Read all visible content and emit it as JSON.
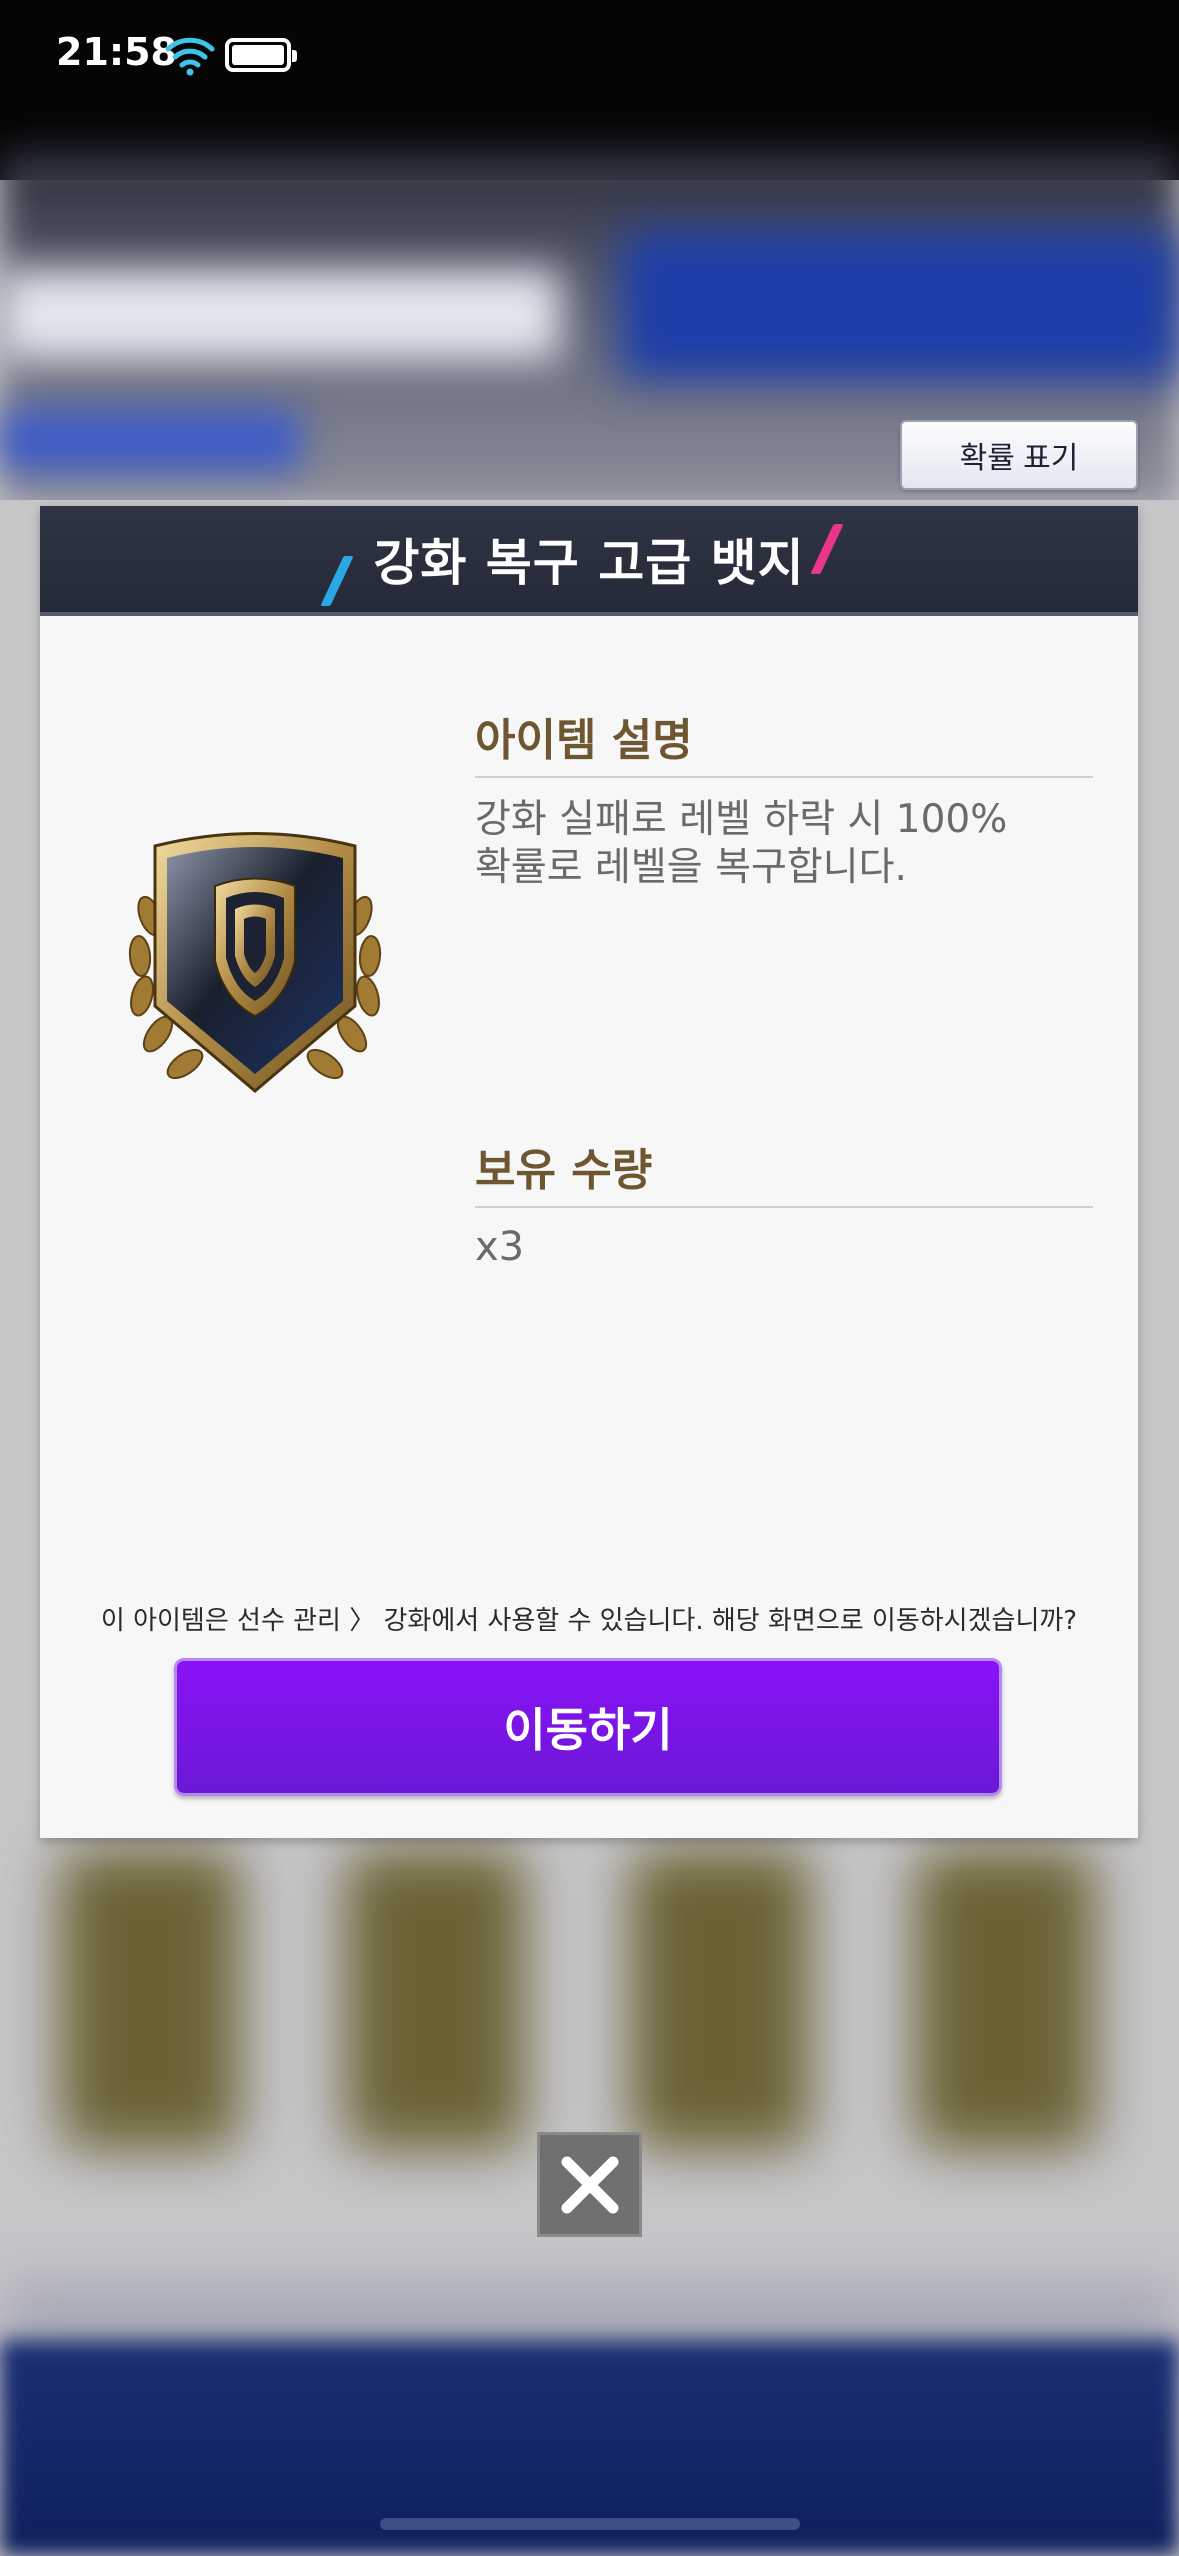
{
  "status_bar": {
    "time": "21:58"
  },
  "probability_button": {
    "label": "확률 표기"
  },
  "modal": {
    "title": "강화 복구 고급 뱃지",
    "description_heading": "아이템 설명",
    "description_lines": [
      "강화 실패로 레벨 하락 시 100%",
      "확률로 레벨을 복구합니다."
    ],
    "quantity_heading": "보유 수량",
    "quantity_value": "x3",
    "hint": "이 아이템은 선수 관리 〉 강화에서 사용할 수 있습니다. 해당 화면으로 이동하시겠습니까?",
    "move_button_label": "이동하기"
  },
  "colors": {
    "header_bg": "#2b3040",
    "accent_purple": "#7a14e8",
    "section_title": "#6d5630",
    "slash_blue": "#2aa8e6",
    "slash_pink": "#e8368a"
  },
  "icons": [
    "wifi-icon",
    "battery-icon",
    "shield-badge-icon",
    "close-icon"
  ]
}
